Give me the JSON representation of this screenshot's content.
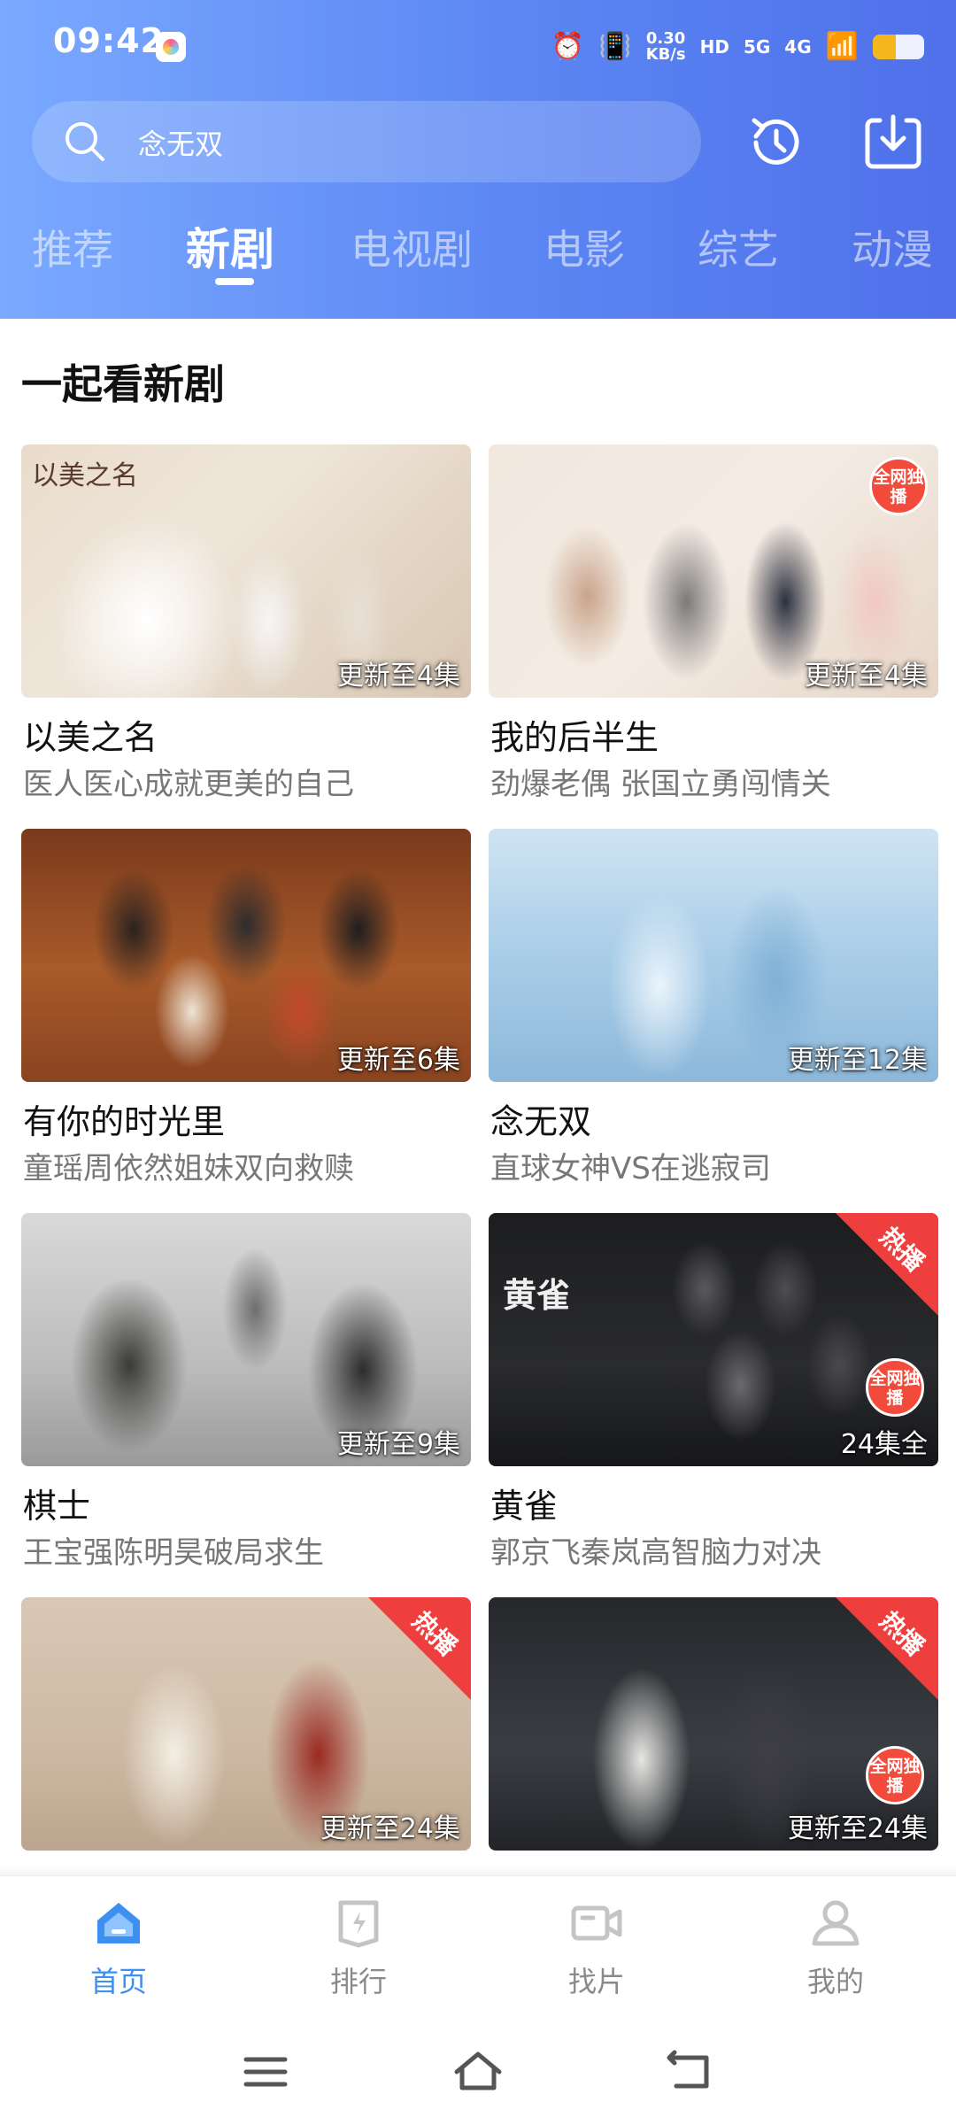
{
  "status_bar": {
    "time": "09:42",
    "net_speed_value": "0.30",
    "net_speed_unit": "KB/s",
    "hd_label": "HD",
    "net_5g": "5G",
    "net_4g": "4G",
    "battery_level": 0.45
  },
  "search": {
    "placeholder": "念无双"
  },
  "tabs": [
    {
      "label": "推荐"
    },
    {
      "label": "新剧"
    },
    {
      "label": "电视剧"
    },
    {
      "label": "电影"
    },
    {
      "label": "综艺"
    },
    {
      "label": "动漫"
    }
  ],
  "active_tab": "新剧",
  "section": {
    "title": "一起看新剧"
  },
  "cards": [
    {
      "title": "以美之名",
      "subtitle": "医人医心成就更美的自己",
      "badge": "更新至4集",
      "poster_logo": "以美之名"
    },
    {
      "title": "我的后半生",
      "subtitle": "劲爆老偶 张国立勇闯情关",
      "badge": "更新至4集",
      "stamp": "全网独播"
    },
    {
      "title": "有你的时光里",
      "subtitle": "童瑶周依然姐妹双向救赎",
      "badge": "更新至6集"
    },
    {
      "title": "念无双",
      "subtitle": "直球女神VS在逃寂司",
      "badge": "更新至12集"
    },
    {
      "title": "棋士",
      "subtitle": "王宝强陈明昊破局求生",
      "badge": "更新至9集"
    },
    {
      "title": "黄雀",
      "subtitle": "郭京飞秦岚高智脑力对决",
      "badge": "24集全",
      "corner": "热播",
      "stamp": "全网独播",
      "poster_logo": "黄雀"
    },
    {
      "badge": "更新至24集",
      "corner": "热播"
    },
    {
      "badge": "更新至24集",
      "corner": "热播",
      "stamp": "全网独播"
    }
  ],
  "bottom_nav": [
    {
      "label": "首页",
      "icon": "home-icon",
      "active": true
    },
    {
      "label": "排行",
      "icon": "ranking-icon"
    },
    {
      "label": "找片",
      "icon": "video-camera-icon"
    },
    {
      "label": "我的",
      "icon": "user-icon"
    }
  ],
  "colors": {
    "accent": "#3d8ff0",
    "header_start": "#7aa9ff",
    "header_end": "#4f70ea",
    "hot_badge": "#ef3e3e"
  }
}
